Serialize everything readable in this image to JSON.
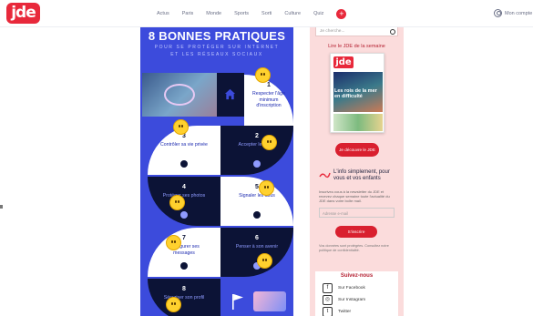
{
  "nav": {
    "logo": "jde",
    "items": [
      "Actus",
      "Paris",
      "Monde",
      "Sports",
      "Sorti",
      "Culture",
      "Quiz"
    ],
    "plus": "+",
    "account": "Mon compte"
  },
  "infographic": {
    "title": "8 BONNES PRATIQUES",
    "subtitle": "POUR SE PROTÉGER SUR INTERNET ET LES RÉSEAUX SOCIAUX",
    "steps": [
      {
        "num": "1",
        "text": "Respecter l'âge minimum d'inscription"
      },
      {
        "num": "2",
        "text": "Accepter les amis"
      },
      {
        "num": "3",
        "text": "Contrôler sa vie privée"
      },
      {
        "num": "4",
        "text": "Protéger ses photos"
      },
      {
        "num": "5",
        "text": "Signaler les abus"
      },
      {
        "num": "6",
        "text": "Penser à son avenir"
      },
      {
        "num": "7",
        "text": "Configurer ses messages"
      },
      {
        "num": "8",
        "text": "Sécuriser son profil"
      }
    ]
  },
  "sidebar": {
    "search_placeholder": "Je cherche...",
    "magazine_heading": "Lire le JDE de la semaine",
    "magazine_logo": "jde",
    "magazine_headline": "Les rois de la mer en difficulté",
    "read_button": "Je découvre le JDE",
    "newsletter_title": "L'info simplement, pour vous et vos enfants",
    "newsletter_text": "Inscrivez-vous à la newsletter du JDE et recevez chaque semaine toute l'actualité du JDE dans votre boîte mail.",
    "email_placeholder": "Adresse e-mail",
    "subscribe_button": "S'inscrire",
    "legal": "Vos données sont protégées. Consultez notre politique de confidentialité.",
    "follow_heading": "Suivez-nous",
    "social": [
      {
        "icon": "facebook-icon",
        "glyph": "f",
        "label": "Sur Facebook"
      },
      {
        "icon": "instagram-icon",
        "glyph": "◎",
        "label": "Sur Instagram"
      },
      {
        "icon": "twitter-icon",
        "glyph": "t",
        "label": "Twitter"
      }
    ]
  },
  "colors": {
    "brand_red": "#e8293b",
    "info_blue": "#3c4bdc",
    "info_navy": "#0c1336",
    "sidebar_pink": "#fbdcdc"
  }
}
